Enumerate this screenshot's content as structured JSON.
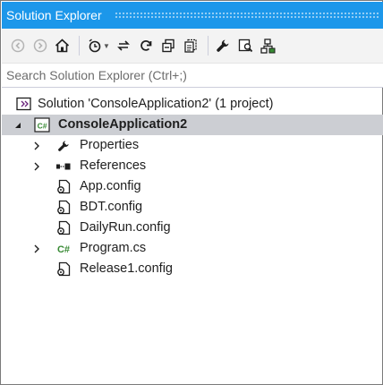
{
  "title": "Solution Explorer",
  "search": {
    "placeholder": "Search Solution Explorer (Ctrl+;)"
  },
  "tree": {
    "solution": "Solution 'ConsoleApplication2' (1 project)",
    "project": "ConsoleApplication2",
    "project_icon_text": "C#",
    "items": [
      {
        "label": "Properties"
      },
      {
        "label": "References"
      },
      {
        "label": "App.config"
      },
      {
        "label": "BDT.config"
      },
      {
        "label": "DailyRun.config"
      },
      {
        "label": "Program.cs",
        "icon_text": "C#"
      },
      {
        "label": "Release1.config"
      }
    ]
  },
  "colors": {
    "title_bar": "#1c97ea",
    "selection": "#ccced3",
    "csharp_green": "#388a34"
  }
}
